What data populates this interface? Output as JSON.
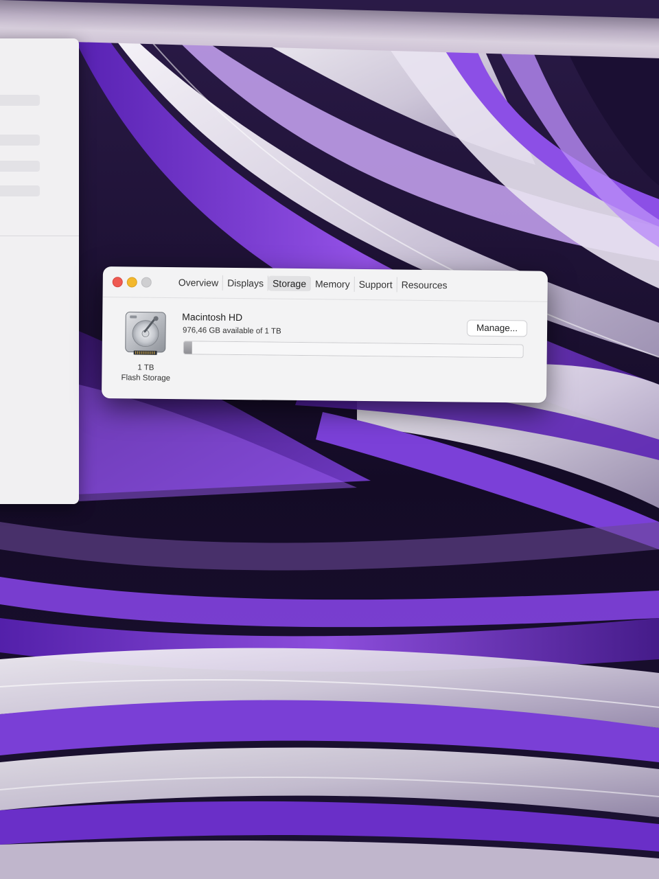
{
  "window": {
    "tabs": [
      {
        "label": "Overview",
        "active": false
      },
      {
        "label": "Displays",
        "active": false
      },
      {
        "label": "Storage",
        "active": true
      },
      {
        "label": "Memory",
        "active": false
      },
      {
        "label": "Support",
        "active": false
      },
      {
        "label": "Resources",
        "active": false
      }
    ]
  },
  "storage": {
    "disk_icon": "hard-drive-icon",
    "disk_name": "Macintosh HD",
    "available_text": "976,46 GB available of 1 TB",
    "capacity_label": "1 TB",
    "type_label": "Flash Storage",
    "manage_label": "Manage...",
    "used_fraction": 0.024
  },
  "colors": {
    "close": "#ee5a52",
    "minimize": "#f3b82d",
    "zoom_inactive": "#cfcfd1",
    "wallpaper_purple": "#7a3fd6"
  }
}
